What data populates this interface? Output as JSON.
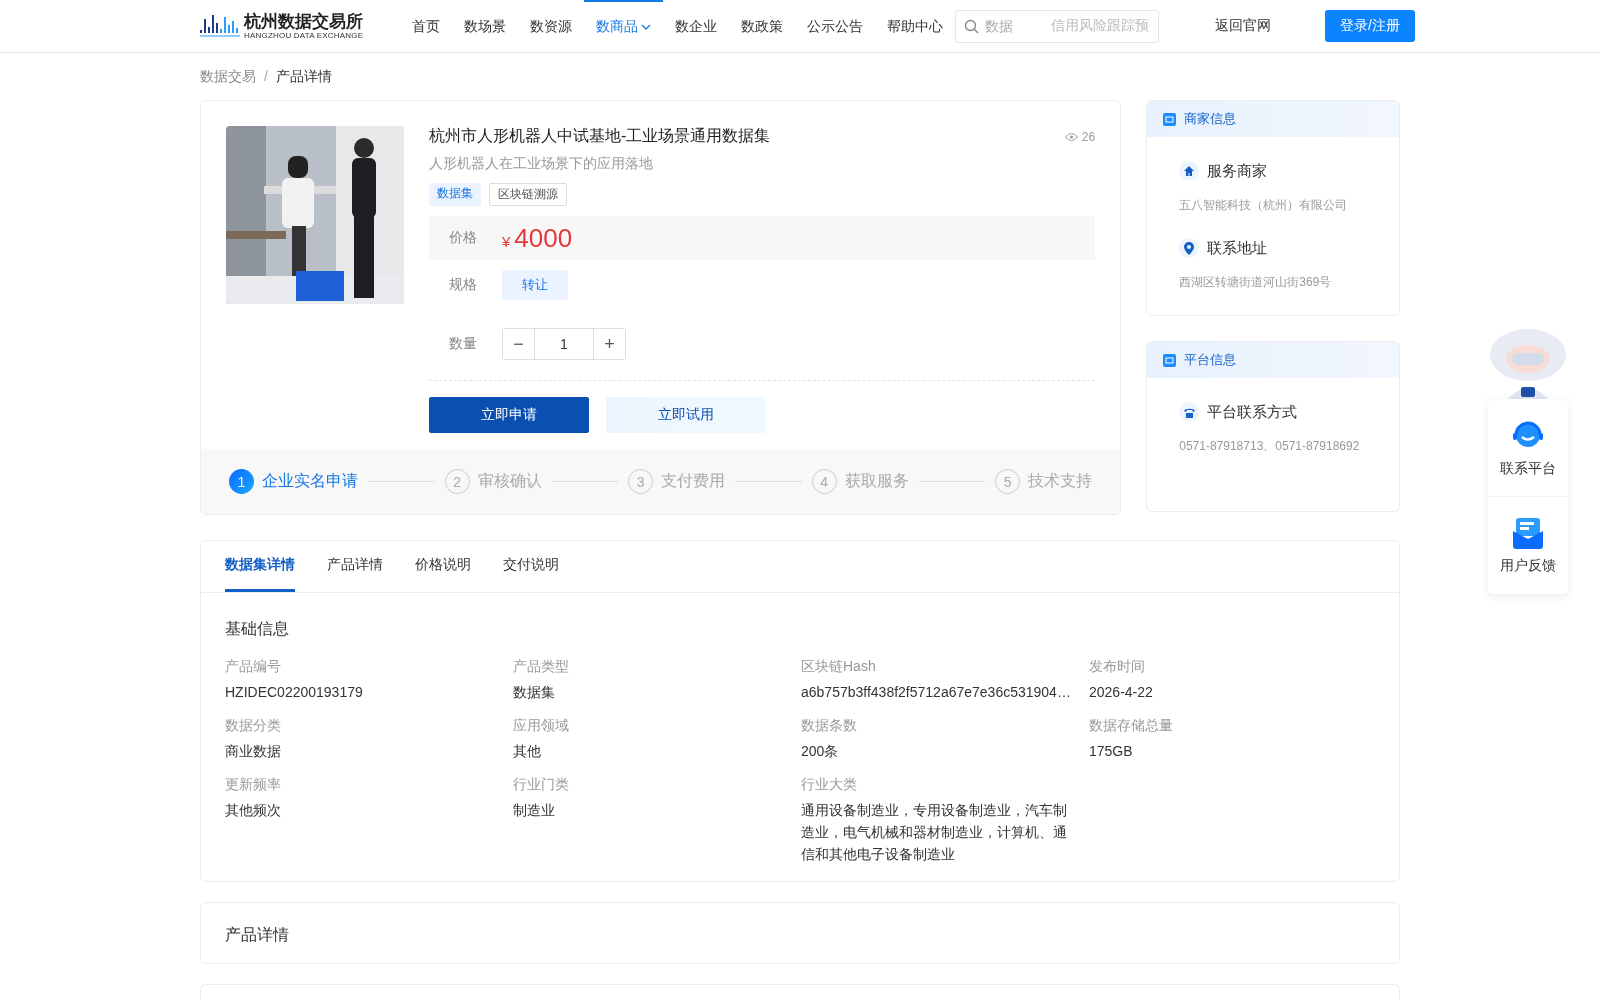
{
  "header": {
    "logo": {
      "name": "杭州数据交易所",
      "subtitle": "HANGZHOU DATA EXCHANGE"
    },
    "nav": [
      {
        "label": "首页",
        "selected": false,
        "dropdown": false
      },
      {
        "label": "数场景",
        "selected": false,
        "dropdown": false
      },
      {
        "label": "数资源",
        "selected": false,
        "dropdown": false
      },
      {
        "label": "数商品",
        "selected": true,
        "dropdown": true
      },
      {
        "label": "数企业",
        "selected": false,
        "dropdown": false
      },
      {
        "label": "数政策",
        "selected": false,
        "dropdown": false
      },
      {
        "label": "公示公告",
        "selected": false,
        "dropdown": false
      },
      {
        "label": "帮助中心",
        "selected": false,
        "dropdown": false
      }
    ],
    "search": {
      "placeholder": "数据",
      "hint": "信用风险跟踪预"
    },
    "back_link": "返回官网",
    "login_button": "登录/注册"
  },
  "breadcrumb": [
    "数据交易",
    "产品详情"
  ],
  "breadcrumb_separator": "/",
  "product": {
    "title": "杭州市人形机器人中试基地-工业场景通用数据集",
    "subtitle": "人形机器人在工业场景下的应用落地",
    "views": "26",
    "tags": [
      {
        "label": "数据集",
        "kind": "primary"
      },
      {
        "label": "区块链溯源",
        "kind": "outline"
      }
    ],
    "price_label": "价格",
    "currency": "¥",
    "price": "4000",
    "spec_label": "规格",
    "specs": [
      {
        "label": "转让",
        "selected": true
      }
    ],
    "quantity_label": "数量",
    "quantity": "1",
    "minus": "−",
    "plus": "+",
    "buttons": [
      {
        "label": "立即申请",
        "kind": "primary"
      },
      {
        "label": "立即试用",
        "kind": "secondary"
      }
    ],
    "steps": [
      {
        "number": "1",
        "label": "企业实名申请",
        "selected": true
      },
      {
        "number": "2",
        "label": "审核确认",
        "selected": false
      },
      {
        "number": "3",
        "label": "支付费用",
        "selected": false
      },
      {
        "number": "4",
        "label": "获取服务",
        "selected": false
      },
      {
        "number": "5",
        "label": "技术支持",
        "selected": false
      }
    ]
  },
  "merchant_card": {
    "title": "商家信息",
    "items": [
      {
        "label": "服务商家",
        "value": "五八智能科技（杭州）有限公司"
      },
      {
        "label": "联系地址",
        "value": "西湖区转塘街道河山街369号"
      }
    ]
  },
  "platform_card": {
    "title": "平台信息",
    "items": [
      {
        "label": "平台联系方式",
        "value": "0571-87918713、0571-87918692"
      }
    ]
  },
  "tabs": [
    {
      "label": "数据集详情",
      "selected": true
    },
    {
      "label": "产品详情",
      "selected": false
    },
    {
      "label": "价格说明",
      "selected": false
    },
    {
      "label": "交付说明",
      "selected": false
    }
  ],
  "basic_info": {
    "title": "基础信息",
    "fields": [
      {
        "label": "产品编号",
        "value": "HZIDEC02200193179"
      },
      {
        "label": "产品类型",
        "value": "数据集"
      },
      {
        "label": "区块链Hash",
        "value": "a6b757b3ff438f2f5712a67e7e36c531904…"
      },
      {
        "label": "发布时间",
        "value": "2026-4-22"
      },
      {
        "label": "数据分类",
        "value": "商业数据"
      },
      {
        "label": "应用领域",
        "value": "其他"
      },
      {
        "label": "数据条数",
        "value": "200条"
      },
      {
        "label": "数据存储总量",
        "value": "175GB"
      },
      {
        "label": "更新频率",
        "value": "其他频次"
      },
      {
        "label": "行业门类",
        "value": "制造业"
      },
      {
        "label": "行业大类",
        "value": "通用设备制造业，专用设备制造业，汽车制造业，电气机械和器材制造业，计算机、通信和其他电子设备制造业"
      }
    ]
  },
  "detail_section": {
    "title": "产品详情"
  },
  "float_widget": [
    {
      "label": "联系平台"
    },
    {
      "label": "用户反馈"
    }
  ]
}
